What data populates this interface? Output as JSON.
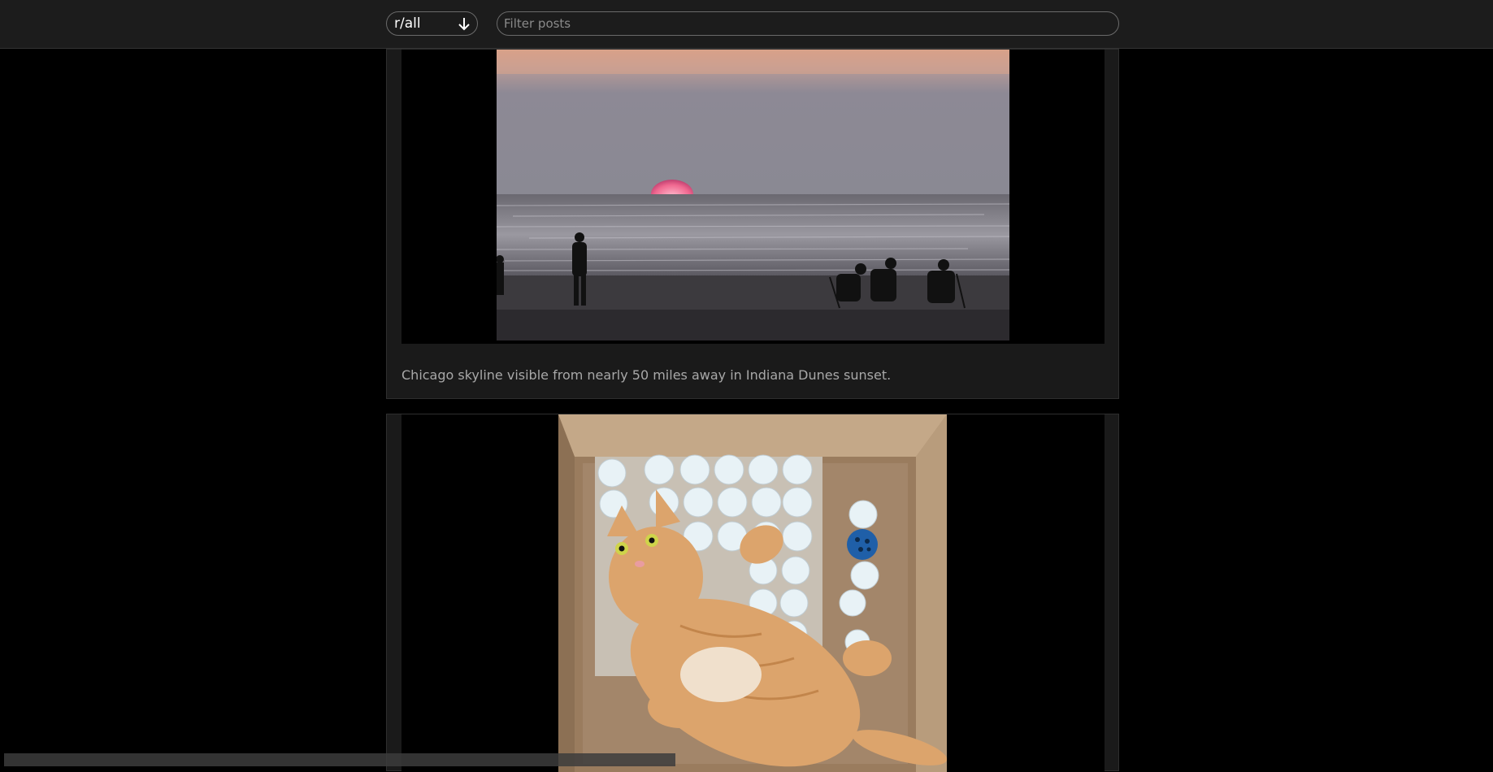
{
  "header": {
    "subreddit_label": "r/all",
    "sort_icon": "arrow-down-icon",
    "filter_placeholder": "Filter posts",
    "filter_value": ""
  },
  "posts": [
    {
      "caption": "Chicago skyline visible from nearly 50 miles away in Indiana Dunes sunset.",
      "image": "sunset-beach-photo"
    },
    {
      "caption": "",
      "image": "cat-in-egg-box-photo"
    }
  ],
  "colors": {
    "background": "#000000",
    "topbar": "#1c1c1c",
    "card": "#1a1a1a",
    "border": "#6a6a6a"
  }
}
